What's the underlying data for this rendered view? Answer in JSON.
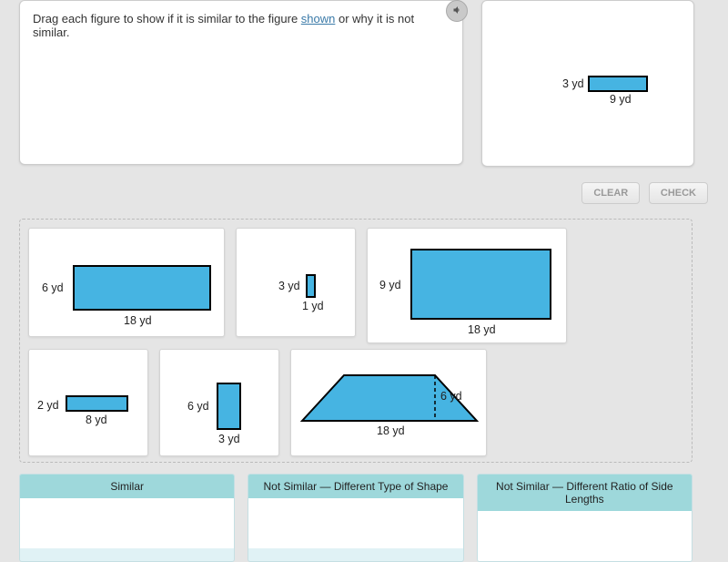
{
  "prompt": {
    "pre": "Drag each figure to show if it is similar to the figure ",
    "link": "shown",
    "post": " or why it is not similar."
  },
  "reference": {
    "h": "3 yd",
    "w": "9 yd"
  },
  "buttons": {
    "clear": "CLEAR",
    "check": "CHECK"
  },
  "tiles": {
    "a": {
      "h": "6 yd",
      "w": "18 yd"
    },
    "b": {
      "h": "3 yd",
      "w": "1 yd"
    },
    "c": {
      "h": "9 yd",
      "w": "18 yd"
    },
    "d": {
      "h": "2 yd",
      "w": "8 yd"
    },
    "e": {
      "h": "6 yd",
      "w": "3 yd"
    },
    "f": {
      "h": "6 yd",
      "w": "18 yd"
    }
  },
  "buckets": {
    "similar": "Similar",
    "diff_shape": "Not Similar — Different Type of Shape",
    "diff_ratio": "Not Similar — Different Ratio of Side Lengths"
  }
}
